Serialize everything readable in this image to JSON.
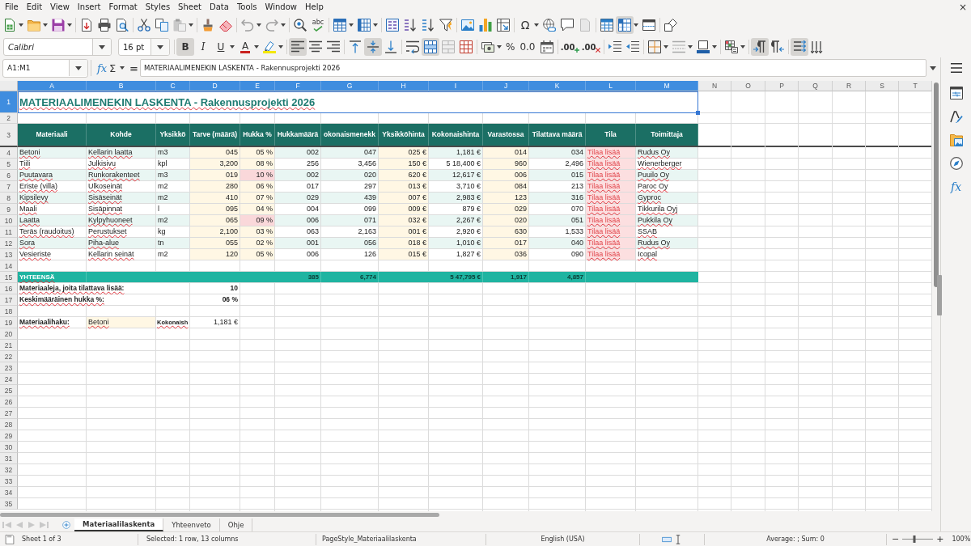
{
  "menu": [
    "File",
    "Edit",
    "View",
    "Insert",
    "Format",
    "Styles",
    "Sheet",
    "Data",
    "Tools",
    "Window",
    "Help"
  ],
  "close_label": "×",
  "standard_toolbar": {
    "spelling_label": "abc",
    "special_character_label": "Ω",
    "toggles": [
      {
        "kind": "freeze-panes",
        "on": true
      }
    ]
  },
  "formatting_toolbar": {
    "font_name": "Calibri",
    "font_size": "16 pt",
    "style_buttons": [
      {
        "kind": "bold",
        "label": "B",
        "on": true
      },
      {
        "kind": "italic",
        "label": "I",
        "on": false
      },
      {
        "kind": "underline",
        "label": "U",
        "on": false
      }
    ],
    "font_color_label": "A",
    "horizontal_align": [
      {
        "kind": "left",
        "on": true
      },
      {
        "kind": "center",
        "on": false
      },
      {
        "kind": "right",
        "on": false
      }
    ],
    "vertical_align": [
      {
        "kind": "top",
        "on": false
      },
      {
        "kind": "middle",
        "on": true
      },
      {
        "kind": "bottom",
        "on": false
      }
    ],
    "text_layout": [
      {
        "kind": "wrap",
        "on": false
      },
      {
        "kind": "merge-center",
        "on": true
      }
    ],
    "percent_label": "%",
    "standard_format_label": "0.0",
    "add_decimal_label": ".00",
    "delete_decimal_label": ".00",
    "paragraph_direction": [
      {
        "kind": "ltr",
        "on": true
      },
      {
        "kind": "rtl",
        "on": false
      }
    ],
    "text_direction": [
      {
        "kind": "left-to-right",
        "on": true
      },
      {
        "kind": "top-to-bottom",
        "on": false
      }
    ]
  },
  "formula_bar": {
    "name_box": "A1:M1",
    "function_wizard": "fx",
    "sum": "Σ",
    "equals": "=",
    "content": "MATERIAALIMENEKIN LASKENTA - Rakennusprojekti 2026"
  },
  "autospellcheck": true,
  "columns": [
    {
      "label": "A",
      "selected": true
    },
    {
      "label": "B",
      "selected": true
    },
    {
      "label": "C",
      "selected": true
    },
    {
      "label": "D",
      "selected": true
    },
    {
      "label": "E",
      "selected": true
    },
    {
      "label": "F",
      "selected": true
    },
    {
      "label": "G",
      "selected": true
    },
    {
      "label": "H",
      "selected": true
    },
    {
      "label": "I",
      "selected": true
    },
    {
      "label": "J",
      "selected": true
    },
    {
      "label": "K",
      "selected": true
    },
    {
      "label": "L",
      "selected": true
    },
    {
      "label": "M",
      "selected": true
    },
    {
      "label": "N",
      "selected": false
    },
    {
      "label": "O",
      "selected": false
    },
    {
      "label": "P",
      "selected": false
    },
    {
      "label": "Q",
      "selected": false
    },
    {
      "label": "R",
      "selected": false
    },
    {
      "label": "S",
      "selected": false
    },
    {
      "label": "T",
      "selected": false
    }
  ],
  "rows": [
    {
      "label": "1",
      "selected": true
    },
    {
      "label": "2",
      "selected": false
    },
    {
      "label": "3",
      "selected": false
    },
    {
      "label": "4",
      "selected": false
    },
    {
      "label": "5",
      "selected": false
    },
    {
      "label": "6",
      "selected": false
    },
    {
      "label": "7",
      "selected": false
    },
    {
      "label": "8",
      "selected": false
    },
    {
      "label": "9",
      "selected": false
    },
    {
      "label": "10",
      "selected": false
    },
    {
      "label": "11",
      "selected": false
    },
    {
      "label": "12",
      "selected": false
    },
    {
      "label": "13",
      "selected": false
    },
    {
      "label": "14",
      "selected": false
    },
    {
      "label": "15",
      "selected": false
    },
    {
      "label": "16",
      "selected": false
    },
    {
      "label": "17",
      "selected": false
    },
    {
      "label": "18",
      "selected": false
    },
    {
      "label": "19",
      "selected": false
    },
    {
      "label": "20",
      "selected": false
    },
    {
      "label": "21",
      "selected": false
    },
    {
      "label": "22",
      "selected": false
    },
    {
      "label": "23",
      "selected": false
    },
    {
      "label": "24",
      "selected": false
    },
    {
      "label": "25",
      "selected": false
    },
    {
      "label": "26",
      "selected": false
    },
    {
      "label": "27",
      "selected": false
    },
    {
      "label": "28",
      "selected": false
    },
    {
      "label": "29",
      "selected": false
    },
    {
      "label": "30",
      "selected": false
    },
    {
      "label": "31",
      "selected": false
    },
    {
      "label": "32",
      "selected": false
    },
    {
      "label": "33",
      "selected": false
    },
    {
      "label": "34",
      "selected": false
    },
    {
      "label": "35",
      "selected": false
    }
  ],
  "sheet": {
    "title": "MATERIAALIMENEKIN LASKENTA - Rakennusprojekti 2026",
    "header": [
      "Materiaali",
      "Kohde",
      "Yksikkö",
      "Tarve (määrä)",
      "Hukka %",
      "Hukkamäärä",
      "okonaismenekk",
      "Yksikköhinta",
      "Kokonaishinta",
      "Varastossa",
      "Tilattava määrä",
      "Tila",
      "Toimittaja"
    ],
    "items": [
      {
        "cells": [
          "Betoni",
          "Kellarin laatta",
          "m3",
          "045",
          "05 %",
          "002",
          "047",
          "025 €",
          "1,181 €",
          "014",
          "034",
          "Tilaa lisää",
          "Rudus Oy"
        ],
        "waste_high": false,
        "status_alert": true
      },
      {
        "cells": [
          "Tiili",
          "Julkisivu",
          "kpl",
          "3,200",
          "08 %",
          "256",
          "3,456",
          "150 €",
          "5 18,400 €",
          "960",
          "2,496",
          "Tilaa lisää",
          "Wienerberger"
        ],
        "waste_high": false,
        "status_alert": true
      },
      {
        "cells": [
          "Puutavara",
          "Runkorakenteet",
          "m3",
          "019",
          "10 %",
          "002",
          "020",
          "620 €",
          "12,617 €",
          "006",
          "015",
          "Tilaa lisää",
          "Puuilo Oy"
        ],
        "waste_high": true,
        "status_alert": true
      },
      {
        "cells": [
          "Eriste (villa)",
          "Ulkoseinät",
          "m2",
          "280",
          "06 %",
          "017",
          "297",
          "013 €",
          "3,710 €",
          "084",
          "213",
          "Tilaa lisää",
          "Paroc Oy"
        ],
        "waste_high": false,
        "status_alert": true
      },
      {
        "cells": [
          "Kipsilevy",
          "Sisäseinät",
          "m2",
          "410",
          "07 %",
          "029",
          "439",
          "007 €",
          "2,983 €",
          "123",
          "316",
          "Tilaa lisää",
          "Gyproc"
        ],
        "waste_high": false,
        "status_alert": true
      },
      {
        "cells": [
          "Maali",
          "Sisäpinnat",
          "l",
          "095",
          "04 %",
          "004",
          "099",
          "009 €",
          "879 €",
          "029",
          "070",
          "Tilaa lisää",
          "Tikkurila Oyj"
        ],
        "waste_high": false,
        "status_alert": true
      },
      {
        "cells": [
          "Laatta",
          "Kylpyhuoneet",
          "m2",
          "065",
          "09 %",
          "006",
          "071",
          "032 €",
          "2,267 €",
          "020",
          "051",
          "Tilaa lisää",
          "Pukkila Oy"
        ],
        "waste_high": true,
        "status_alert": true
      },
      {
        "cells": [
          "Teräs (raudoitus)",
          "Perustukset",
          "kg",
          "2,100",
          "03 %",
          "063",
          "2,163",
          "001 €",
          "2,920 €",
          "630",
          "1,533",
          "Tilaa lisää",
          "SSAB"
        ],
        "waste_high": false,
        "status_alert": true
      },
      {
        "cells": [
          "Sora",
          "Piha-alue",
          "tn",
          "055",
          "02 %",
          "001",
          "056",
          "018 €",
          "1,010 €",
          "017",
          "040",
          "Tilaa lisää",
          "Rudus Oy"
        ],
        "waste_high": false,
        "status_alert": true
      },
      {
        "cells": [
          "Vesieriste",
          "Kellarin seinät",
          "m2",
          "120",
          "05 %",
          "006",
          "126",
          "015 €",
          "1,827 €",
          "036",
          "090",
          "Tilaa lisää",
          "Icopal"
        ],
        "waste_high": false,
        "status_alert": true
      }
    ],
    "totals": {
      "label": "YHTEENSÄ",
      "column_f": "385",
      "column_g": "6,774",
      "column_i": "5 47,795 €",
      "column_j": "1,917",
      "column_k": "4,857"
    },
    "summary": [
      {
        "label": "Materiaaleja, joita tilattava lisää:",
        "value": "10"
      },
      {
        "label": "Keskimääräinen hukka %:",
        "value": "06 %"
      }
    ],
    "lookup": {
      "label": "Materiaalihaku:",
      "input": "Betoni",
      "result_label": "Kokonaish",
      "result": "1,181 €"
    }
  },
  "sheet_tabs": [
    {
      "label": "Materiaalilaskenta",
      "selected": true
    },
    {
      "label": "Yhteenveto",
      "selected": false
    },
    {
      "label": "Ohje",
      "selected": false
    }
  ],
  "sidebar": {
    "functions_label": "fx"
  },
  "status_bar": {
    "sheet": "Sheet 1 of 3",
    "selection": "Selected: 1 row, 13 columns",
    "page_style": "PageStyle_Materiaalilaskenta",
    "language": "English (USA)",
    "summary": "Average: ; Sum: 0",
    "zoom": {
      "minus": "−",
      "plus": "+",
      "level": 0.4,
      "reading": "100%"
    }
  }
}
